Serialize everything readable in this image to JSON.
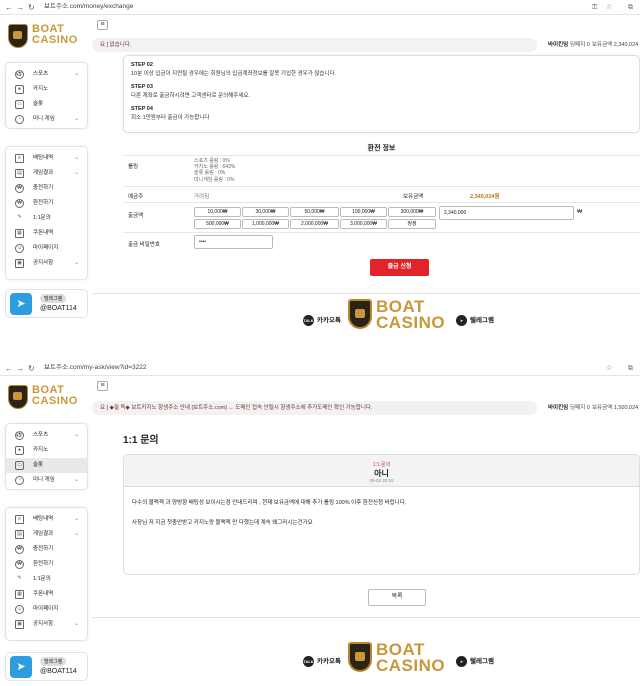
{
  "shot1": {
    "url": "보트주소.com/money/exchange",
    "ticker": "요 ] 없습니다.",
    "user": "바이킨임",
    "points": "딩페지 0",
    "balance": "보유금액 2,340,024",
    "steps": [
      {
        "title": "STEP 02",
        "text": "10분 이상 입금이 지연될 경우에는 회원님의 입금계좌정보를 잘못 기입한 경우가 많습니다."
      },
      {
        "title": "STEP 03",
        "text": "다른 계좌로 출금하시려면 고객센터로 문의해주세요."
      },
      {
        "title": "STEP 04",
        "text": "회소 1만원부터 출금이 가능합니다"
      }
    ],
    "section_title": "환전 정보",
    "rolling_label": "롤링",
    "rolling_lines": [
      "스포츠 롤링 : 0%",
      "카지노 롤링 : 643%",
      "슬롯 롤링 : 0%",
      "미니게임 롤링 : 0%"
    ],
    "holder_label": "예금주",
    "holder_value": "가려짐",
    "balance_label": "보유금액",
    "balance_value": "2,340,024원",
    "withdraw_label": "출금액",
    "amount_buttons": [
      "10,000₩",
      "30,000₩",
      "50,000₩",
      "100,000₩",
      "300,000₩",
      "500,000₩",
      "1,000,000₩",
      "2,000,000₩",
      "3,000,000₩",
      "정정"
    ],
    "withdraw_value": "2,340,000",
    "withdraw_unit": "₩",
    "password_label": "출금 비밀번호",
    "password_value": "••••",
    "submit_label": "출금 신청"
  },
  "shot2": {
    "url": "보트주소.com/my-ask/view?id=3222",
    "ticker": "요 ] ◆필 독◆ 보트카지노 항생주소 안내 [보트주소.com] ← 도메인 접속 안될시 항생주소에 추가도메인 확인 가능합니다.",
    "user": "바이킨임",
    "points": "딩페지 0",
    "balance": "보유금액 1,500,024",
    "page_title": "1:1 문의",
    "q_category": "1:1 문의",
    "q_title": "아니",
    "q_date": "09-03 20:16",
    "q_body1": "다수의 블랙잭 과 양방향 배팅성 보이시는점 안내드리며 , 현재 보유금액에 대해 추가 롤링 100% 이후 환전신청 바랍니다.",
    "q_body2": "사장님 저 지금 첫충안받고 카지노랑 블랙잭 만 다했는데 계속 왜그러시는건가요",
    "list_button": "목록"
  },
  "menu1": [
    "스포츠",
    "카지노",
    "슬롯",
    "미니 게임"
  ],
  "menu2": [
    "배팅내역",
    "게임결과",
    "충전하기",
    "환전하기",
    "1:1문의",
    "쿠폰내역",
    "마이페이지",
    "공지사항"
  ],
  "telegram_badge": "텔레그램",
  "telegram_id": "@BOAT114",
  "brand_line1": "BOAT",
  "brand_line2": "CASINO",
  "kakao_label": "카카오톡",
  "kakao_icon_text": "TALK",
  "telegram_label": "텔레그램",
  "colors": {
    "accent_gold": "#c9973a",
    "submit_red": "#e0242a",
    "telegram_blue": "#2d9de0"
  }
}
